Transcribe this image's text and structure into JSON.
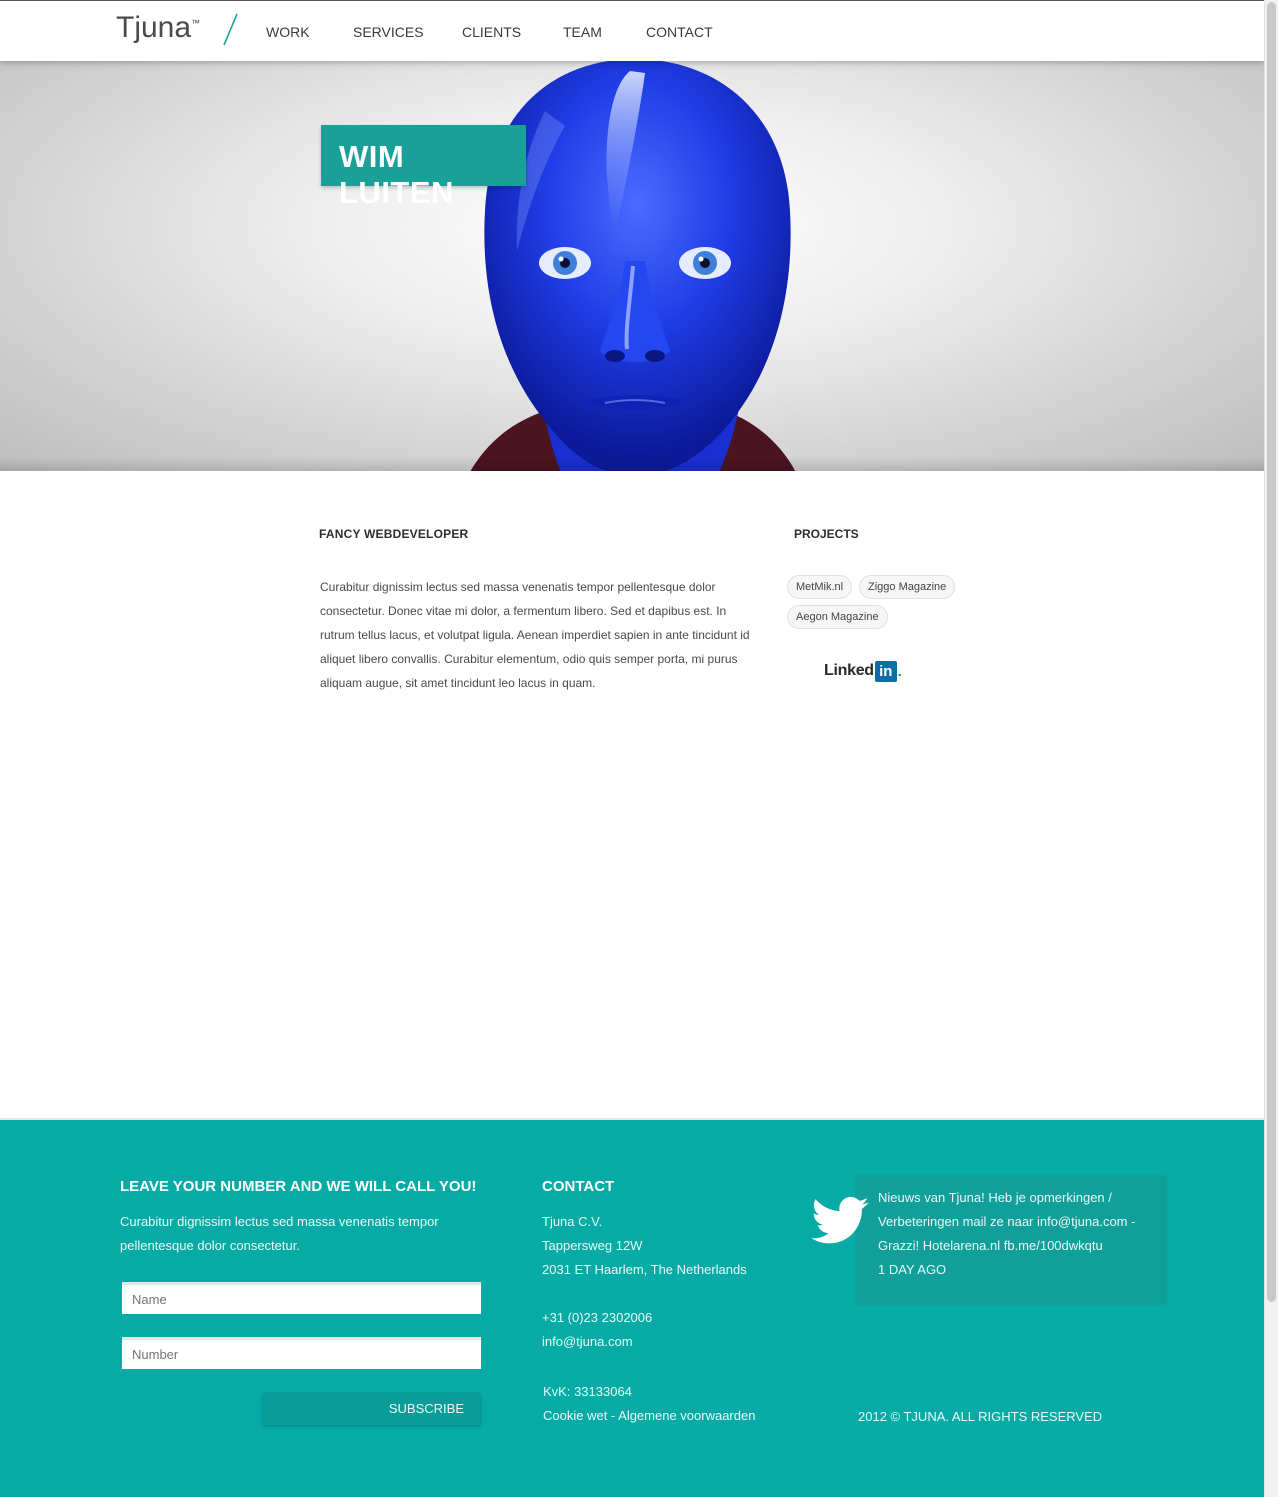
{
  "header": {
    "logo": "Tjuna",
    "nav": [
      "WORK",
      "SERVICES",
      "CLIENTS",
      "TEAM",
      "CONTACT"
    ]
  },
  "hero": {
    "name": "WIM LUITEN"
  },
  "profile": {
    "role": "FANCY WEBDEVELOPER",
    "bio": "Curabitur dignissim lectus sed massa venenatis tempor pellentesque dolor consectetur. Donec vitae mi dolor, a fermentum libero. Sed et dapibus est. In rutrum tellus lacus, et volutpat ligula. Aenean imperdiet sapien in ante tincidunt id aliquet libero convallis. Curabitur elementum, odio quis semper porta, mi purus aliquam augue, sit amet tincidunt leo lacus in quam."
  },
  "projects": {
    "title": "PROJECTS",
    "tags": [
      "MetMik.nl",
      "Ziggo Magazine",
      "Aegon Magazine"
    ],
    "linkedin_text": "Linked",
    "linkedin_box": "in"
  },
  "footer": {
    "cta": {
      "heading": "LEAVE YOUR NUMBER AND WE WILL CALL YOU!",
      "text": "Curabitur dignissim lectus sed massa venenatis tempor pellentesque dolor consectetur.",
      "name_placeholder": "Name",
      "number_placeholder": "Number",
      "subscribe": "SUBSCRIBE"
    },
    "contact": {
      "heading": "CONTACT",
      "company": "Tjuna C.V.",
      "street": "Tappersweg 12W",
      "city": "2031 ET Haarlem, The Netherlands",
      "phone": "+31 (0)23 2302006",
      "email": "info@tjuna.com",
      "kvk": "KvK: 33133064",
      "legal": "Cookie wet - Algemene voorwaarden"
    },
    "twitter": {
      "tweet": "Nieuws van Tjuna! Heb je opmerkingen / Verbeteringen mail ze naar info@tjuna.com - Grazzi! Hotelarena.nl fb.me/100dwkqtu",
      "time": "1 DAY AGO"
    },
    "copyright": "2012 © TJUNA. ALL RIGHTS RESERVED"
  },
  "colors": {
    "accent": "#05aba4",
    "banner": "#1a9f99",
    "linkedin": "#0b6fa4"
  }
}
